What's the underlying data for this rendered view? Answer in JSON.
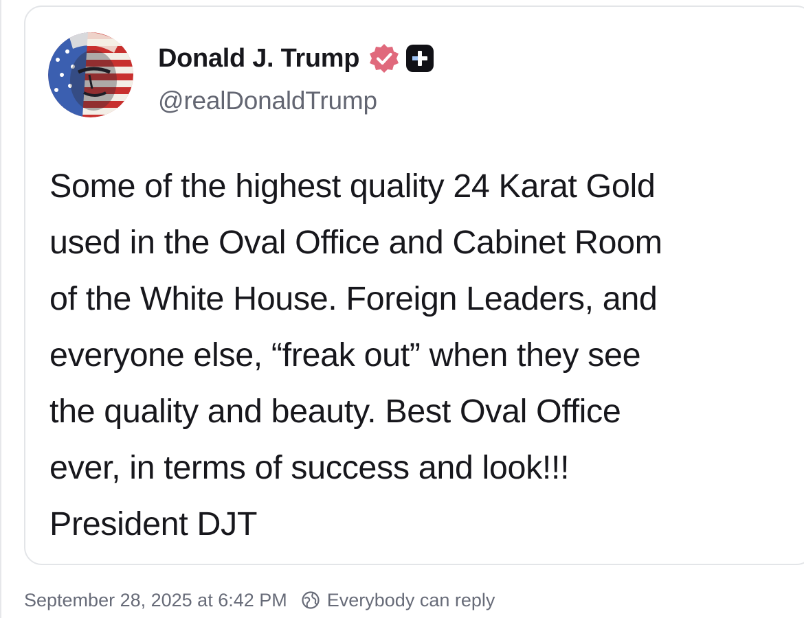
{
  "post": {
    "author": {
      "display_name": "Donald J. Trump",
      "handle": "@realDonaldTrump",
      "avatar_icon": "portrait-flag-avatar",
      "verified_icon": "verified-badge-icon",
      "verified_color": "#e0697c",
      "plus_badge_icon": "plus-badge-icon"
    },
    "body_lines": [
      "Some of the highest quality 24 Karat Gold",
      "used in the Oval Office and Cabinet Room",
      "of the White House. Foreign Leaders, and",
      "everyone else, “freak out” when they see",
      "the quality and beauty. Best Oval Office",
      "ever, in terms of success and look!!!",
      "President DJT"
    ],
    "timestamp": "September 28, 2025 at 6:42 PM",
    "reply_setting": {
      "icon": "globe-reply-icon",
      "label": "Everybody can reply"
    }
  }
}
